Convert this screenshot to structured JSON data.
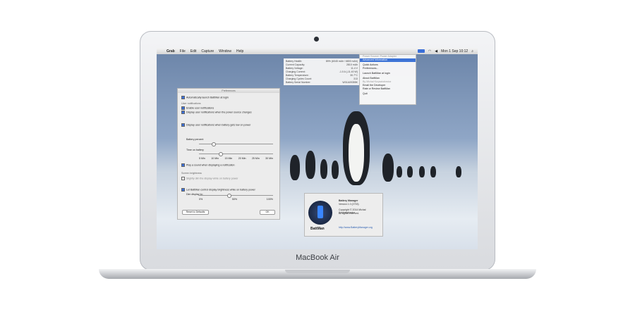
{
  "menubar": {
    "apple_icon": "apple-icon",
    "items": [
      "Grab",
      "File",
      "Edit",
      "Capture",
      "Window",
      "Help"
    ],
    "clock": "Mon 1 Sep 10:12"
  },
  "info_popup": {
    "rows": [
      [
        "Battery Health:",
        "89% (6045 mAh / 6800 mAh)"
      ],
      [
        "Current Capacity:",
        "2810 mAh"
      ],
      [
        "Battery Voltage:",
        "11.4 V"
      ],
      [
        "Charging Current:",
        "-1.0 A (-11.40 W)"
      ],
      [
        "Battery Temperature:",
        "30.7°C"
      ],
      [
        "Charging Cycles Count:",
        "313"
      ],
      [
        "Battery Serial Number:",
        "W01A09355K"
      ]
    ]
  },
  "battman_menu": {
    "items": [
      {
        "label": "Power Source: Power Adapter"
      },
      {
        "label": "Advanced Information",
        "selected": true
      },
      {
        "label": "Quick Actions"
      },
      {
        "label": "Preferences..."
      },
      {
        "label": "Launch BattMan at login"
      },
      {
        "label": "About BattMan"
      },
      {
        "label": "By Michał Krzysztofowicz"
      },
      {
        "label": "Email the Developer"
      },
      {
        "label": "Rate or Review BattMan"
      },
      {
        "label": "Quit"
      }
    ]
  },
  "prefs": {
    "title": "Preferences",
    "launch_login": "Automatically launch BattMan at login",
    "user_notifications_header": "User notifications",
    "enable_notifications": "Enable user notifications",
    "display_power_change": "Display user notifications when the power source changes",
    "display_low_power": "Display user notifications when battery gets low on power",
    "battery_percent": "Battery percent",
    "time_on_battery": "Time on battery",
    "time_ticks": [
      "5 Min",
      "10 Min",
      "15 Min",
      "20 Min",
      "25 Min",
      "30 Min"
    ],
    "play_sound": "Play a sound when displaying a notification",
    "screen_brightness_header": "Screen brightness",
    "dim_display": "Slightly dim the display while on battery power",
    "control_brightness": "Let BattMan control display brightness while on battery power",
    "dim_display_to": "Dim display to:",
    "dim_ticks": [
      "0%",
      "50%",
      "100%"
    ],
    "reset_button": "Reset to Defaults",
    "ok_button": "OK"
  },
  "about": {
    "app_name": "Battery Manager",
    "version": "Version 1.0 (2733)",
    "copyright": "Copyright © 2014 Michał Krzysztofowicz",
    "rights": "All rights reserved.",
    "url": "http://www.BatteryManager.org",
    "badge": "BattMan"
  },
  "laptop": {
    "brand": "MacBook Air"
  }
}
